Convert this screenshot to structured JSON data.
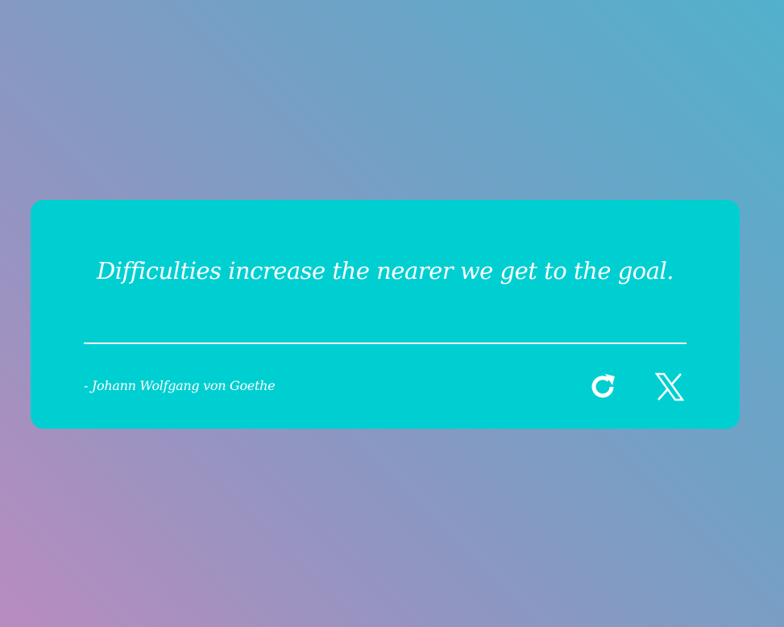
{
  "quote_card": {
    "quote_text": "Difficulties increase the nearer we get to the goal.",
    "author": "- Johann Wolfgang von Goethe",
    "actions": {
      "new_quote_icon": "refresh-icon",
      "share_icon": "x-twitter-icon"
    }
  },
  "colors": {
    "card_background": "#00cfd2",
    "text": "#ffffff",
    "background_gradient": [
      "#b98cc0",
      "#8e96c1",
      "#70a2c6",
      "#51b1cc"
    ]
  }
}
